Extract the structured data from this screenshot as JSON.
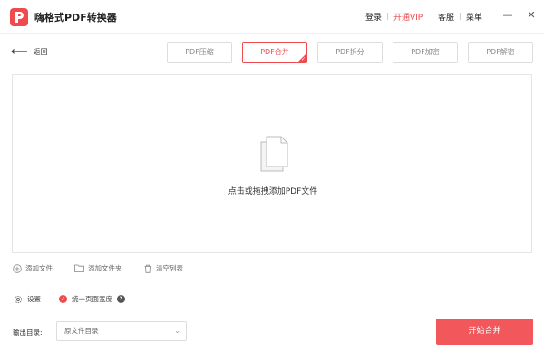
{
  "titlebar": {
    "app_title": "嗨格式PDF转换器",
    "login": "登录",
    "vip": "开通VIP",
    "service": "客服",
    "menu": "菜单",
    "minimize": "—",
    "close": "✕"
  },
  "nav": {
    "back_label": "返回",
    "tabs": [
      "PDF压缩",
      "PDF合并",
      "PDF拆分",
      "PDF加密",
      "PDF解密"
    ],
    "active_tab": "PDF合并"
  },
  "dropzone": {
    "text": "点击或拖拽添加PDF文件"
  },
  "actions": {
    "add_file": "添加文件",
    "add_folder": "添加文件夹",
    "clear_list": "清空列表"
  },
  "settings": {
    "settings_label": "设置",
    "unify_width": "统一页面宽度",
    "unify_width_checked": true
  },
  "output": {
    "label": "输出目录:",
    "select_value": "原文件目录",
    "start_button": "开始合并"
  },
  "colors": {
    "accent": "#ef4a4e",
    "button": "#f2575b"
  }
}
